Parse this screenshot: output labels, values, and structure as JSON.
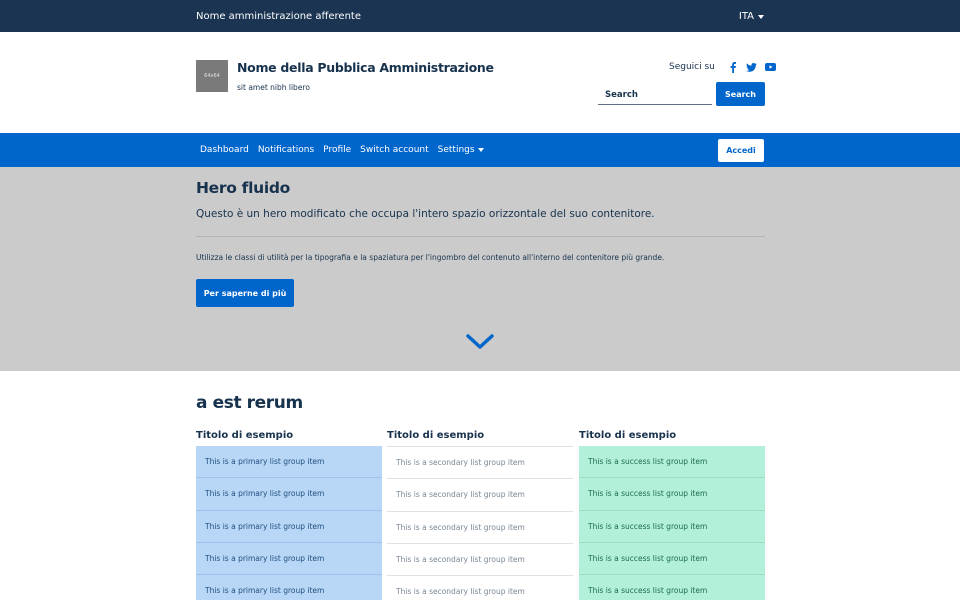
{
  "top_bar": {
    "ente": "Nome amministrazione afferente",
    "language": "ITA"
  },
  "header": {
    "logo_placeholder": "64x64",
    "title": "Nome della Pubblica Amministrazione",
    "tagline": "sit amet nibh libero",
    "social_label": "Seguici su",
    "social_icons": [
      "facebook-icon",
      "twitter-icon",
      "youtube-icon"
    ],
    "search_placeholder": "Search",
    "search_button": "Search"
  },
  "nav": {
    "items": [
      "Dashboard",
      "Notifications",
      "Profile",
      "Switch account"
    ],
    "dropdown": "Settings",
    "login_button": "Accedi"
  },
  "hero": {
    "title": "Hero fluido",
    "lead": "Questo è un hero modificato che occupa l'intero spazio orizzontale del suo contenitore.",
    "description": "Utilizza le classi di utilità per la tipografia e la spaziatura per l'ingombro del contenuto all'interno del contenitore più grande.",
    "cta": "Per saperne di più",
    "scroll_icon": "chevron-down-icon"
  },
  "section": {
    "title": "a est rerum",
    "columns": [
      {
        "title": "Titolo di esempio",
        "variant": "primary",
        "items": [
          "This is a primary list group item",
          "This is a primary list group item",
          "This is a primary list group item",
          "This is a primary list group item",
          "This is a primary list group item"
        ]
      },
      {
        "title": "Titolo di esempio",
        "variant": "secondary",
        "items": [
          "This is a secondary list group item",
          "This is a secondary list group item",
          "This is a secondary list group item",
          "This is a secondary list group item",
          "This is a secondary list group item"
        ]
      },
      {
        "title": "Titolo di esempio",
        "variant": "success",
        "items": [
          "This is a success list group item",
          "This is a success list group item",
          "This is a success list group item",
          "This is a success list group item",
          "This is a success list group item"
        ]
      }
    ]
  },
  "colors": {
    "slim_header": "#1a3452",
    "primary": "#0066cc",
    "hero_bg": "#cbcbcb",
    "text": "#17324d"
  }
}
